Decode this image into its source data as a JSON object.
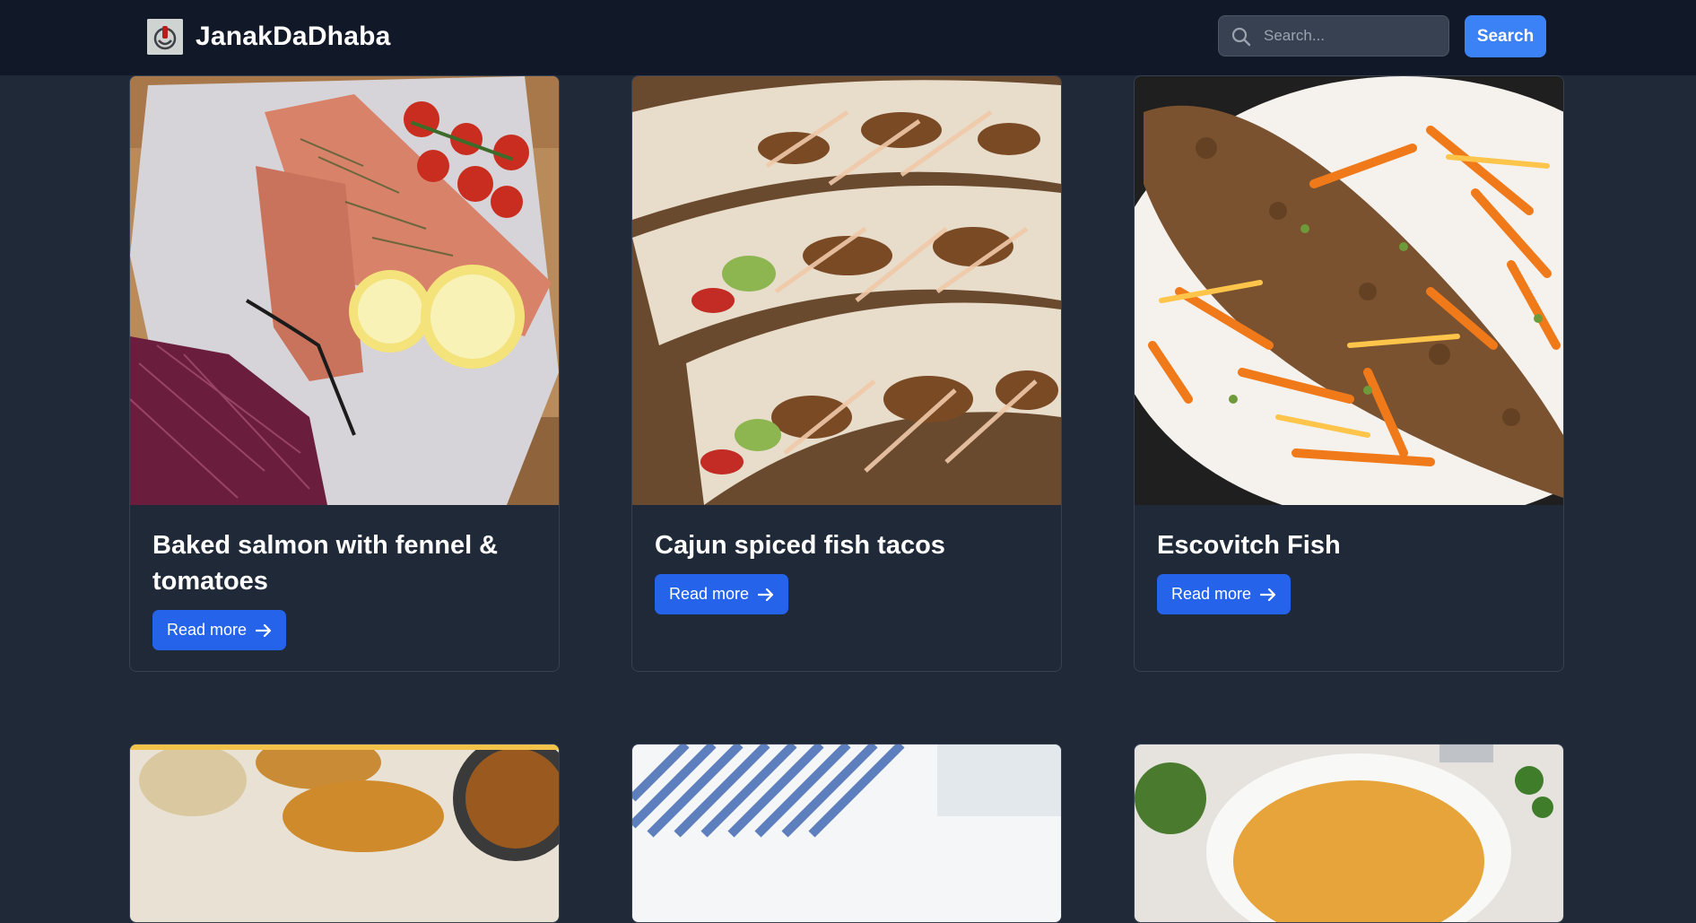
{
  "header": {
    "brand_name": "JanakDaDhaba",
    "logo_icon": "site-logo-icon",
    "search": {
      "placeholder": "Search...",
      "value": ""
    },
    "search_button_label": "Search"
  },
  "colors": {
    "page_bg": "#1f2937",
    "navbar_bg": "#111827",
    "primary_button": "#2563eb",
    "search_button": "#3b82f6"
  },
  "cards": [
    {
      "title": "Baked salmon with fennel & tomatoes",
      "button_label": "Read more",
      "image": "baked-salmon-image"
    },
    {
      "title": "Cajun spiced fish tacos",
      "button_label": "Read more",
      "image": "fish-tacos-image"
    },
    {
      "title": "Escovitch Fish",
      "button_label": "Read more",
      "image": "escovitch-fish-image"
    },
    {
      "image": "fish-cakes-image"
    },
    {
      "image": "blue-striped-cloth-image"
    },
    {
      "image": "soup-bowl-image"
    }
  ]
}
